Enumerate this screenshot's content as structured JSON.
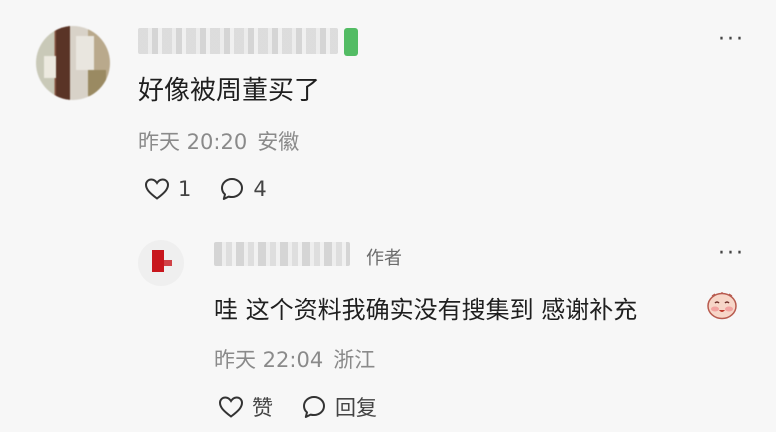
{
  "main_comment": {
    "text": "好像被周董买了",
    "time": "昨天 20:20",
    "location": "安徽",
    "likes": "1",
    "comments": "4",
    "more_label": "···"
  },
  "reply": {
    "author_tag": "作者",
    "text": "哇 这个资料我确实没有搜集到 感谢补充",
    "time": "昨天 22:04",
    "location": "浙江",
    "like_label": "赞",
    "reply_label": "回复",
    "more_label": "···"
  },
  "colors": {
    "text": "#1f1f1f",
    "meta": "#8a8a8a",
    "badge_green": "#36b24a",
    "reply_avatar_red": "#c8161d"
  }
}
